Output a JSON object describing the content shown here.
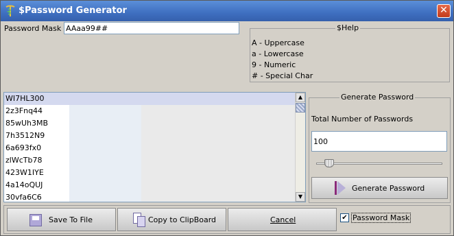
{
  "window": {
    "title": "$Password Generator",
    "close_glyph": "✕"
  },
  "mask": {
    "label": "Password Mask",
    "value": "AAaa99##"
  },
  "help": {
    "title": "$Help",
    "lines": [
      "A - Uppercase",
      "a - Lowercase",
      "9 - Numeric",
      "# - Special Char"
    ]
  },
  "passwords": [
    "WI7HL300",
    "2z3Fnq44",
    "85wUh3MB",
    "7h3512N9",
    "6a693fx0",
    "zlWcTb78",
    "423W1IYE",
    "4a14oQUJ",
    "30vfa6C6"
  ],
  "generate": {
    "title": "Generate Password",
    "total_label": "Total Number of Passwords",
    "count_value": "100",
    "slider_fraction": 0.1,
    "button_label": "Generate Password"
  },
  "buttons": {
    "save": "Save To File",
    "copy": "Copy to ClipBoard",
    "cancel": "Cancel"
  },
  "checkbox": {
    "label": "Password Mask",
    "checked": true,
    "mark": "✔"
  },
  "icons": {
    "app": "caduceus-icon",
    "save": "floppy-disk-icon",
    "copy": "clipboard-copy-icon",
    "generate": "play-icon",
    "close": "close-icon"
  },
  "colors": {
    "titlebar": "#3f6fc0",
    "selection": "#d4d9ef",
    "window_bg": "#d4d0c8"
  }
}
